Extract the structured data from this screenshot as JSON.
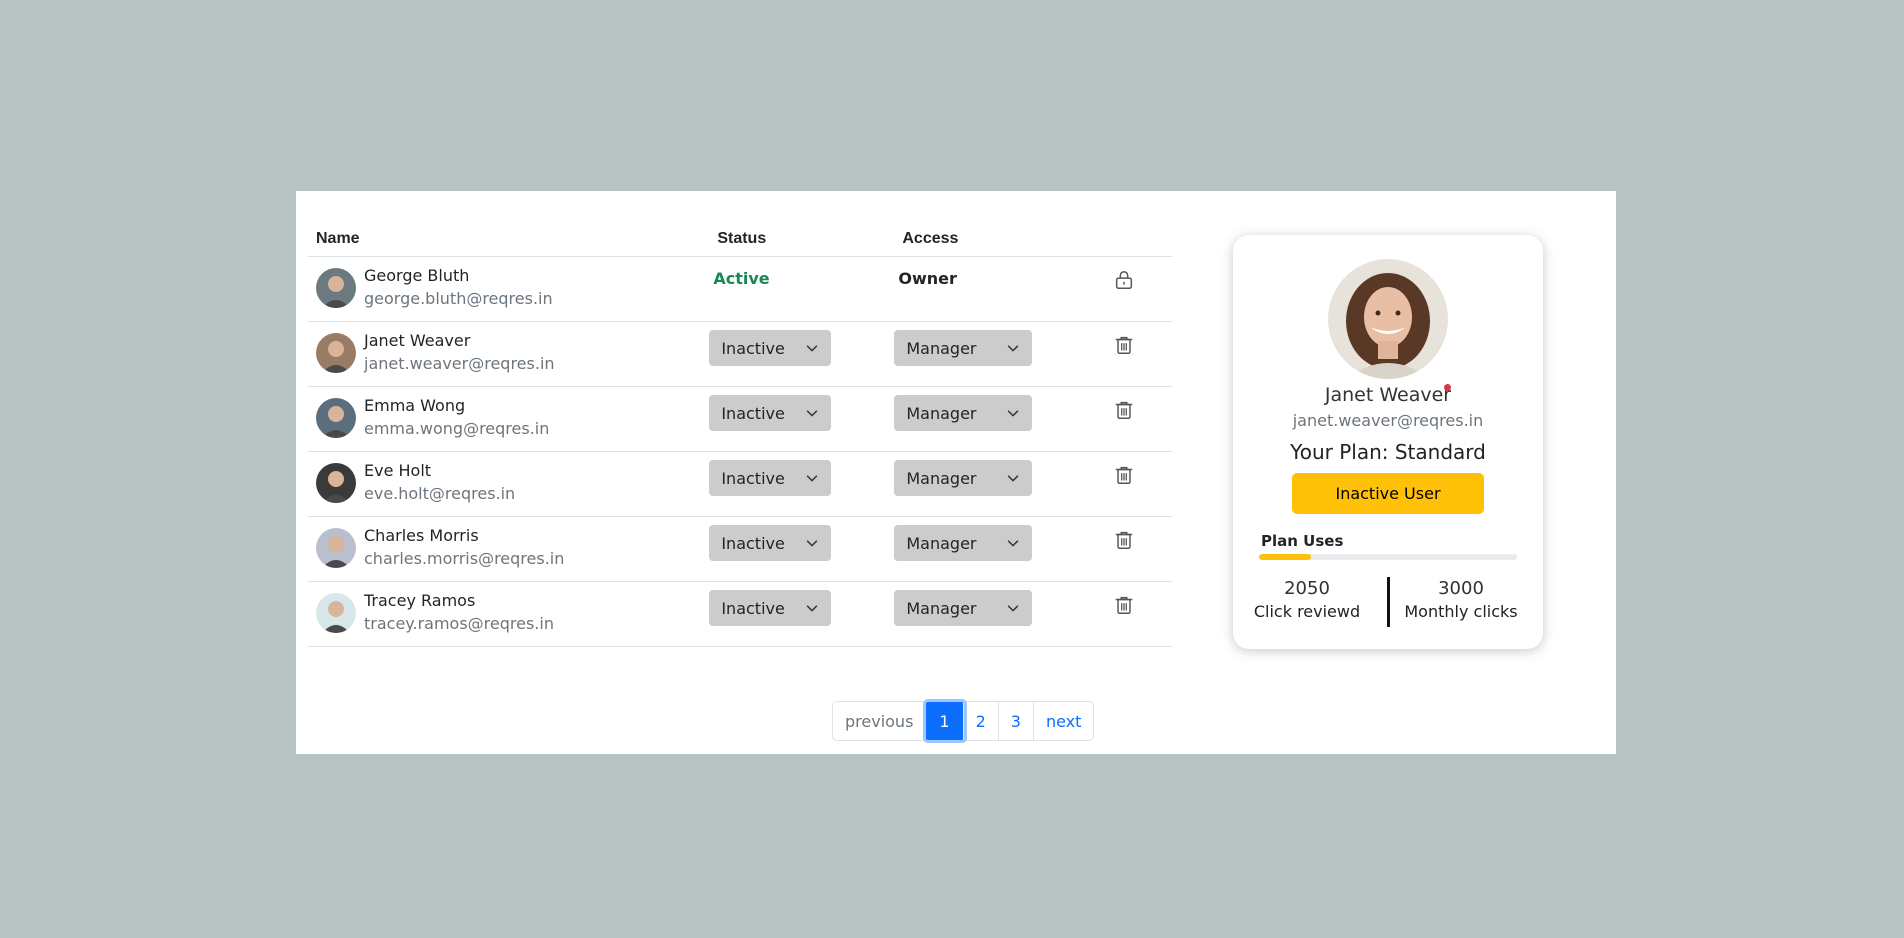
{
  "table": {
    "headers": {
      "name": "Name",
      "status": "Status",
      "access": "Access"
    },
    "rows": [
      {
        "name": "George Bluth",
        "email": "george.bluth@reqres.in",
        "status": "Active",
        "access": "Owner",
        "action_icon": "lock-icon",
        "avatar_bg": "#6b7a80"
      },
      {
        "name": "Janet Weaver",
        "email": "janet.weaver@reqres.in",
        "status": "Inactive",
        "access": "Manager",
        "action_icon": "trash-icon",
        "avatar_bg": "#9a7b63"
      },
      {
        "name": "Emma Wong",
        "email": "emma.wong@reqres.in",
        "status": "Inactive",
        "access": "Manager",
        "action_icon": "trash-icon",
        "avatar_bg": "#5a6e7e"
      },
      {
        "name": "Eve Holt",
        "email": "eve.holt@reqres.in",
        "status": "Inactive",
        "access": "Manager",
        "action_icon": "trash-icon",
        "avatar_bg": "#3a3a3a"
      },
      {
        "name": "Charles Morris",
        "email": "charles.morris@reqres.in",
        "status": "Inactive",
        "access": "Manager",
        "action_icon": "trash-icon",
        "avatar_bg": "#b9bfcc"
      },
      {
        "name": "Tracey Ramos",
        "email": "tracey.ramos@reqres.in",
        "status": "Inactive",
        "access": "Manager",
        "action_icon": "trash-icon",
        "avatar_bg": "#d8e7ea"
      }
    ]
  },
  "pagination": {
    "previous": "previous",
    "pages": [
      "1",
      "2",
      "3"
    ],
    "current_page": "1",
    "next": "next"
  },
  "profile_card": {
    "name": "Janet Weaver",
    "email": "janet.weaver@reqres.in",
    "plan": "Your Plan: Standard",
    "button_label": "Inactive User",
    "plan_uses_label": "Plan Uses",
    "plan_uses_fraction": 0.2,
    "stats": [
      {
        "value": "2050",
        "label": "Click reviewd"
      },
      {
        "value": "3000",
        "label": "Monthly clicks"
      }
    ]
  },
  "colors": {
    "background": "#b7c3c3",
    "active_status": "#198754",
    "accent_yellow": "#ffc107",
    "link_blue": "#0d6efd",
    "online_dot": "#dc3545"
  }
}
